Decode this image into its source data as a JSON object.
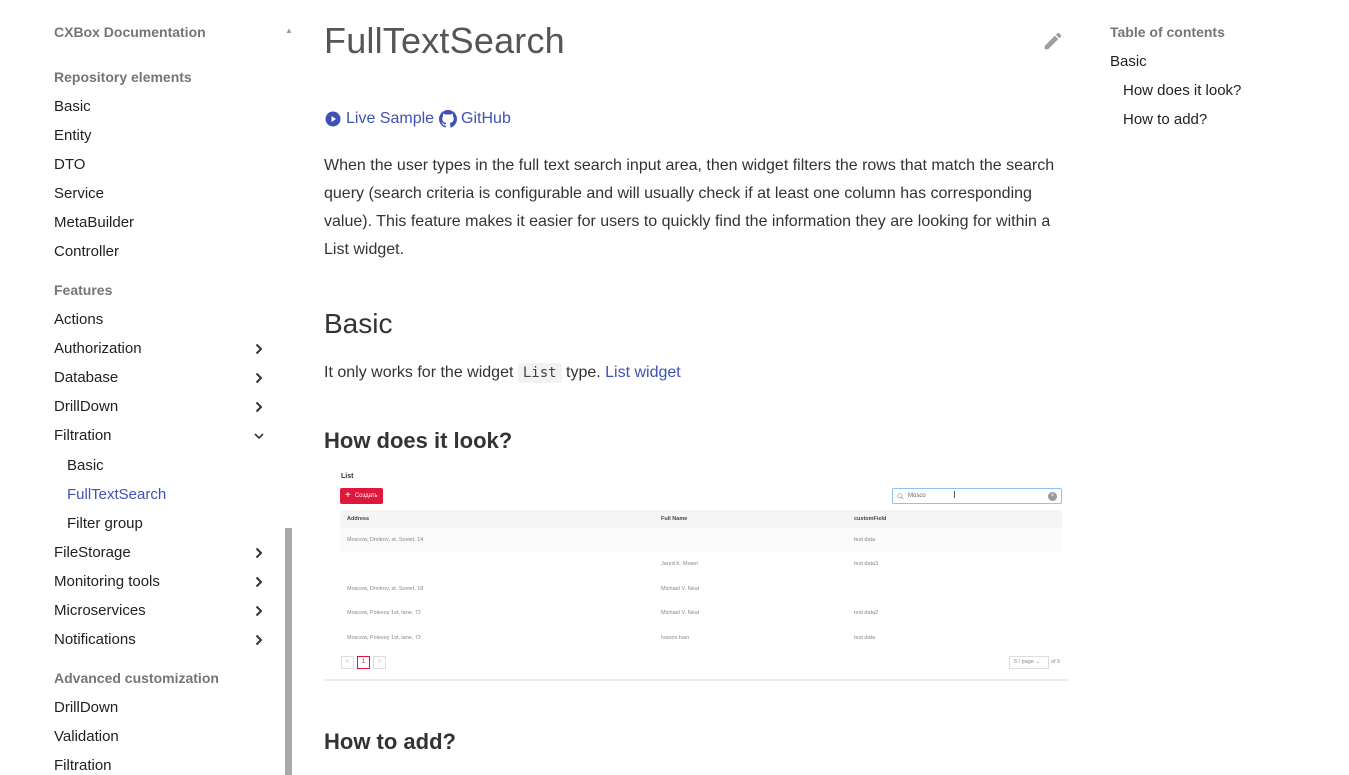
{
  "sidebar": {
    "title": "CXBox Documentation",
    "sections": [
      {
        "label": "Repository elements"
      },
      {
        "label": "Features"
      },
      {
        "label": "Advanced customization"
      }
    ],
    "items": [
      {
        "label": "Basic"
      },
      {
        "label": "Entity"
      },
      {
        "label": "DTO"
      },
      {
        "label": "Service"
      },
      {
        "label": "MetaBuilder"
      },
      {
        "label": "Controller"
      },
      {
        "label": "Actions"
      },
      {
        "label": "Authorization"
      },
      {
        "label": "Database"
      },
      {
        "label": "DrillDown"
      },
      {
        "label": "Filtration"
      },
      {
        "label": "Basic"
      },
      {
        "label": "FullTextSearch"
      },
      {
        "label": "Filter group"
      },
      {
        "label": "FileStorage"
      },
      {
        "label": "Monitoring tools"
      },
      {
        "label": "Microservices"
      },
      {
        "label": "Notifications"
      },
      {
        "label": "DrillDown"
      },
      {
        "label": "Validation"
      },
      {
        "label": "Filtration"
      }
    ],
    "active_item": "FullTextSearch",
    "active_color": "#3f51b5"
  },
  "main": {
    "title": "FullTextSearch",
    "live_sample_label": "Live Sample",
    "github_label": "GitHub",
    "intro": "When the user types in the full text search input area, then widget filters the rows that match the search query (search criteria is configurable and will usually check if at least one column has corresponding value). This feature makes it easier for users to quickly find the information they are looking for within a List widget.",
    "basic_heading": "Basic",
    "basic_text_before": "It only works for the widget ",
    "basic_code": "List",
    "basic_text_after": " type. ",
    "basic_link": "List widget",
    "how_look_heading": "How does it look?",
    "how_add_heading": "How to add?"
  },
  "widget_screenshot": {
    "title": "List",
    "create_label": "Создать",
    "search_value": "Mosco",
    "columns": [
      "Address",
      "Full Name",
      "customField"
    ],
    "rows": [
      [
        "Moscow, Dmitrov, st. Soviet, 14",
        "",
        "test data"
      ],
      [
        "",
        "Jared K. Moser",
        "test data3"
      ],
      [
        "Moscow, Dmitrov, st. Soviet, 18",
        "Michael V. Neal",
        ""
      ],
      [
        "Moscow, Polevoy 1st, lane, 72",
        "Michael V. Neal",
        "test data2"
      ],
      [
        "Moscow, Polevoy 1st, lane, 72",
        "Ivanov Ivan",
        "test data"
      ]
    ],
    "pager_prev": "<",
    "pager_current": "1",
    "pager_next": ">",
    "page_size": "5 / page",
    "total": "of 5",
    "accent_color": "#e0173d"
  },
  "toc": {
    "title": "Table of contents",
    "entries": [
      {
        "label": "Basic"
      },
      {
        "label": "How does it look?"
      },
      {
        "label": "How to add?"
      }
    ]
  }
}
